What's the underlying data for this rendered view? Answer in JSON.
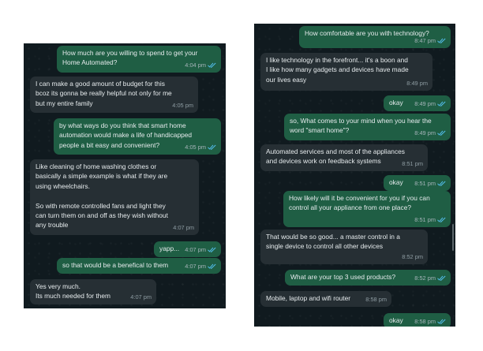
{
  "left_chat": {
    "messages": [
      {
        "dir": "out",
        "text": "How much are you willing to spend to get your\nHome Automated?",
        "time": "4:04 pm",
        "read": true
      },
      {
        "dir": "in",
        "text": "I can make a good amount of budget for this\nbcoz its gonna be really helpful not only for me\nbut my entire family",
        "time": "4:05 pm"
      },
      {
        "dir": "out",
        "text": "by what ways do you think that smart home\nautomation would make a life of handicapped\npeople a bit easy and convenient?",
        "time": "4:05 pm",
        "read": true
      },
      {
        "dir": "in",
        "text": "Like cleaning of home washing clothes or\nbasically a simple example is what if they are\nusing wheelchairs.\n\nSo with remote controlled fans and light they\ncan turn them on and off as they wish without\nany trouble",
        "time": "4:07 pm"
      },
      {
        "dir": "out",
        "text": "yapp...",
        "time": "4:07 pm",
        "read": true
      },
      {
        "dir": "out",
        "text": "so that would be a benefical to them",
        "time": "4:07 pm",
        "read": true
      },
      {
        "dir": "in",
        "text": "Yes very much.\nIts much needed for them",
        "time": "4:07 pm"
      }
    ]
  },
  "right_chat": {
    "messages": [
      {
        "dir": "out",
        "text": "How comfortable are you with technology?",
        "time": "8:47 pm",
        "read": true
      },
      {
        "dir": "in",
        "text": "I like technology in the forefront... it's a boon and\nI like how many gadgets and devices have made\nour lives easy",
        "time": "8:49 pm"
      },
      {
        "dir": "out",
        "text": "okay",
        "time": "8:49 pm",
        "read": true
      },
      {
        "dir": "out",
        "text": "so, What comes to your mind when you hear the\nword \"smart home\"?",
        "time": "8:49 pm",
        "read": true
      },
      {
        "dir": "in",
        "text": "Automated services and most of the appliances\nand devices work on feedback systems",
        "time": "8:51 pm"
      },
      {
        "dir": "out",
        "text": "okay",
        "time": "8:51 pm",
        "read": true
      },
      {
        "dir": "out",
        "text": "How likely will it be convenient for you if you can\ncontrol all your appliance from one place?",
        "time": "8:51 pm",
        "read": true
      },
      {
        "dir": "in",
        "text": "That would be so good... a master control in a\nsingle device to control all other devices",
        "time": "8:52 pm"
      },
      {
        "dir": "out",
        "text": "What are your top 3 used products?",
        "time": "8:52 pm",
        "read": true
      },
      {
        "dir": "in",
        "text": "Mobile, laptop and wifi router",
        "time": "8:58 pm"
      },
      {
        "dir": "out",
        "text": "okay",
        "time": "8:58 pm",
        "read": true
      }
    ]
  },
  "colors": {
    "panel_bg": "#101a1f",
    "outgoing_bubble": "#1f5e44",
    "incoming_bubble": "#262f34",
    "message_text": "#e6ebed",
    "read_ticks": "#53bdeb"
  },
  "icons": {
    "read_receipt": "double-check-icon"
  }
}
